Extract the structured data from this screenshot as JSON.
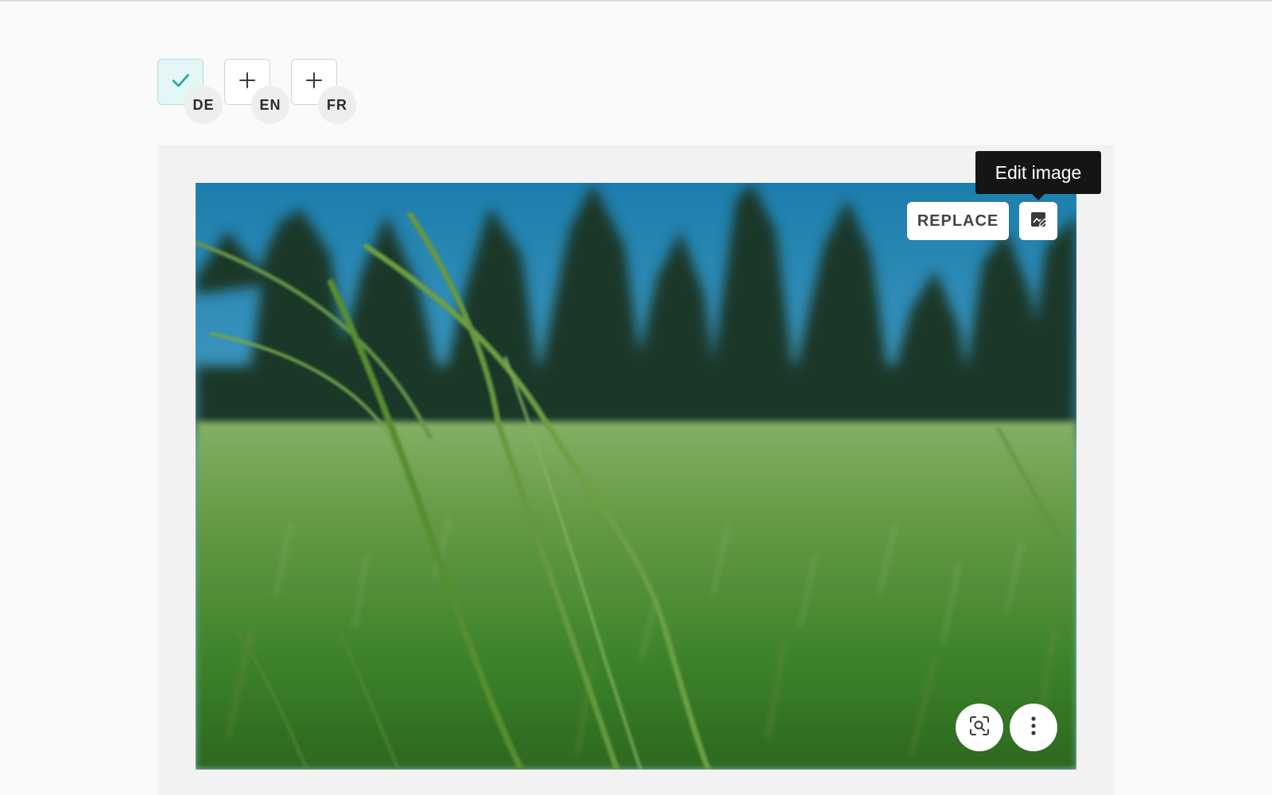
{
  "languages": [
    {
      "code": "DE",
      "state": "active",
      "icon": "check-icon"
    },
    {
      "code": "EN",
      "state": "add",
      "icon": "plus-icon"
    },
    {
      "code": "FR",
      "state": "add",
      "icon": "plus-icon"
    }
  ],
  "toolbar": {
    "replace_label": "REPLACE",
    "edit_icon": "edit-image-icon",
    "tooltip": "Edit image"
  },
  "image": {
    "subject": "grass-meadow-photo"
  },
  "image_actions": {
    "focus_icon": "focus-point-icon",
    "more_icon": "more-vertical-icon"
  },
  "colors": {
    "accent": "#17a79c",
    "active_bg": "#e4f6f5",
    "tooltip_bg": "#151515",
    "panel_bg": "#f2f2f2"
  }
}
